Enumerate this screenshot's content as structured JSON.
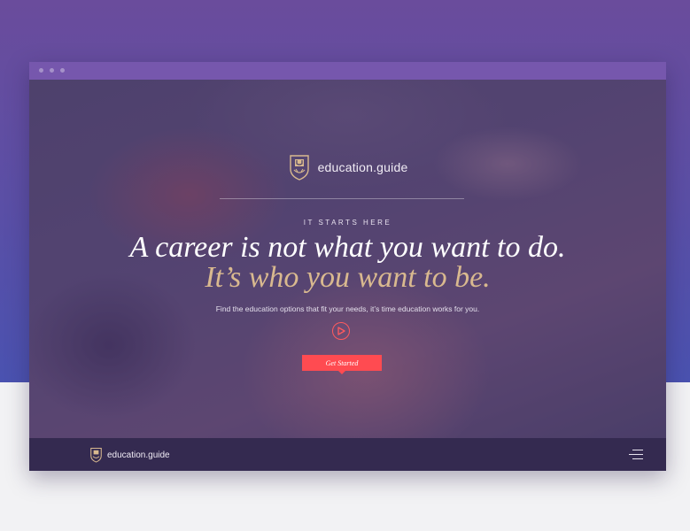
{
  "brand": {
    "name": "education.guide"
  },
  "hero": {
    "kicker": "IT STARTS HERE",
    "headline": "A career is not what you want to do.",
    "subheadline": "It’s who you want to be.",
    "lede": "Find the education options that fit your needs, it’s time education works for you.",
    "cta_label": "Get Started",
    "play_icon": "play-circle-icon"
  },
  "footer": {
    "brand": "education.guide",
    "menu_icon": "hamburger-menu-icon"
  },
  "colors": {
    "accent": "#ff4b51",
    "gold": "#d9b98f",
    "footer_bg": "#342a50",
    "frame_bg": "#6a4c9c"
  }
}
